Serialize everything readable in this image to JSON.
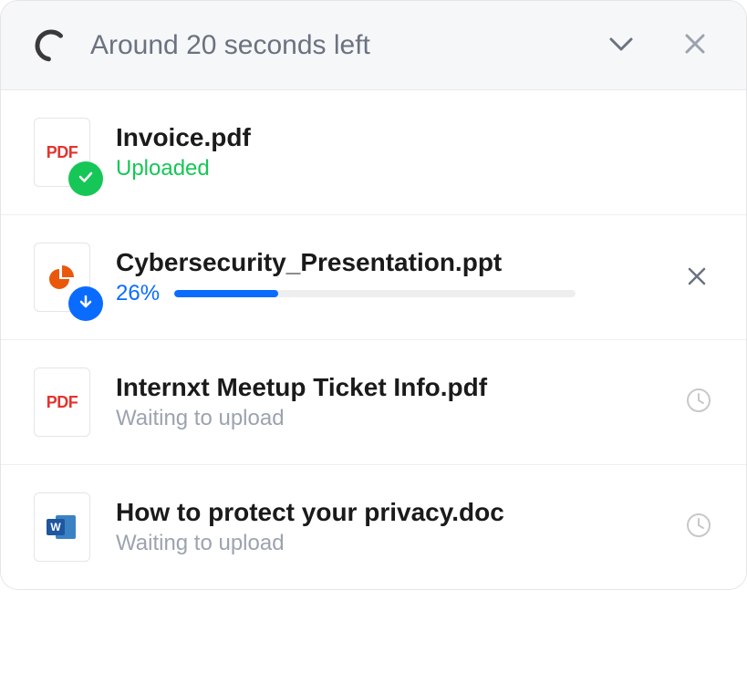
{
  "header": {
    "title": "Around 20 seconds left"
  },
  "files": [
    {
      "name": "Invoice.pdf",
      "status_text": "Uploaded",
      "type": "pdf",
      "state": "uploaded"
    },
    {
      "name": "Cybersecurity_Presentation.ppt",
      "progress_text": "26%",
      "progress_value": 26,
      "type": "ppt",
      "state": "uploading"
    },
    {
      "name": "Internxt Meetup Ticket Info.pdf",
      "status_text": "Waiting to upload",
      "type": "pdf",
      "state": "waiting"
    },
    {
      "name": "How to protect your privacy.doc",
      "status_text": "Waiting to upload",
      "type": "doc",
      "state": "waiting"
    }
  ],
  "colors": {
    "accent": "#0A6BFF",
    "success": "#16C757",
    "muted": "#9CA3AF",
    "pdf_red": "#E3342F",
    "ppt_orange": "#EA580C",
    "word_blue": "#1E56A0"
  }
}
